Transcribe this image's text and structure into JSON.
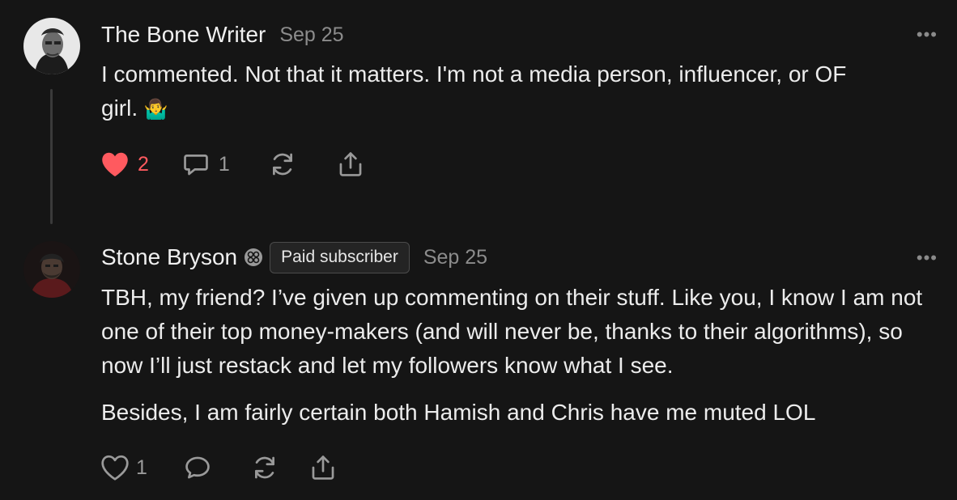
{
  "comments": [
    {
      "author": "The Bone Writer",
      "date": "Sep 25",
      "more": "•••",
      "text_line1": "I commented. Not that it matters. I'm not a media person, influencer, or OF",
      "text_line2": "girl.",
      "emoji": "🤷‍♂️",
      "likes": "2",
      "liked": true,
      "replies": "1"
    },
    {
      "author": "Stone Bryson",
      "badge": "Paid subscriber",
      "date": "Sep 25",
      "more": "•••",
      "paragraph1": "TBH, my friend? I’ve given up commenting on their stuff. Like you, I know I am not one of their top money-makers (and will never be, thanks to their algorithms), so now I’ll just restack and let my followers know what I see.",
      "paragraph2": "Besides, I am fairly certain both Hamish and Chris have me muted LOL",
      "likes": "1",
      "liked": false
    }
  ],
  "colors": {
    "background": "#151515",
    "liked": "#ff5a5f",
    "muted": "#8c8c8c"
  },
  "icons": [
    "heart-icon",
    "comment-icon",
    "restack-icon",
    "share-icon",
    "subscriber-badge-icon",
    "more-icon"
  ]
}
